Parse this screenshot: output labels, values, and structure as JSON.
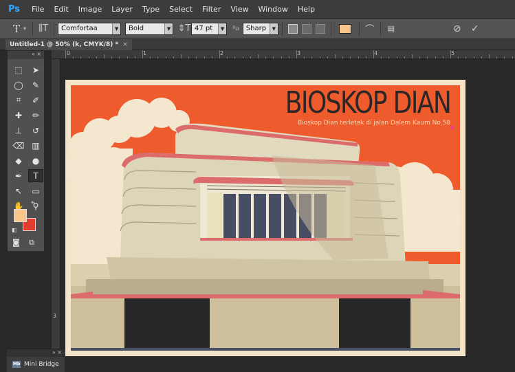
{
  "app": {
    "logo": "Ps"
  },
  "menu": [
    "File",
    "Edit",
    "Image",
    "Layer",
    "Type",
    "Select",
    "Filter",
    "View",
    "Window",
    "Help"
  ],
  "options": {
    "tool_glyph": "T",
    "orientation_glyph": "⫼T",
    "font_family": "Comfortaa",
    "font_style": "Bold",
    "size_glyph": "⇕T",
    "font_size": "47 pt",
    "aa_label": "ªa",
    "antialias": "Sharp",
    "text_color": "#f9c58a",
    "cancel_glyph": "⊘",
    "commit_glyph": "✓"
  },
  "document": {
    "tab_title": "Untitled-1 @ 50% (k, CMYK/8) *",
    "tab_close": "×"
  },
  "ruler": {
    "h_marks": [
      "0",
      "1",
      "2",
      "3",
      "4",
      "5"
    ],
    "v_marks": [
      "3"
    ]
  },
  "toolpanel": {
    "collapse": "« ×"
  },
  "colors": {
    "foreground": "#f9c58a",
    "background": "#e23b30",
    "orange_bg": "#ee5b2c",
    "cream": "#efe4c7"
  },
  "artwork": {
    "title": "BIOSKOP DIAN",
    "subtitle": "Bioskop Dian terletak di jalan Dalem Kaum No.58"
  },
  "minibridge": {
    "collapse": "» ×",
    "label": "Mini Bridge",
    "icon_text": "Mb"
  }
}
